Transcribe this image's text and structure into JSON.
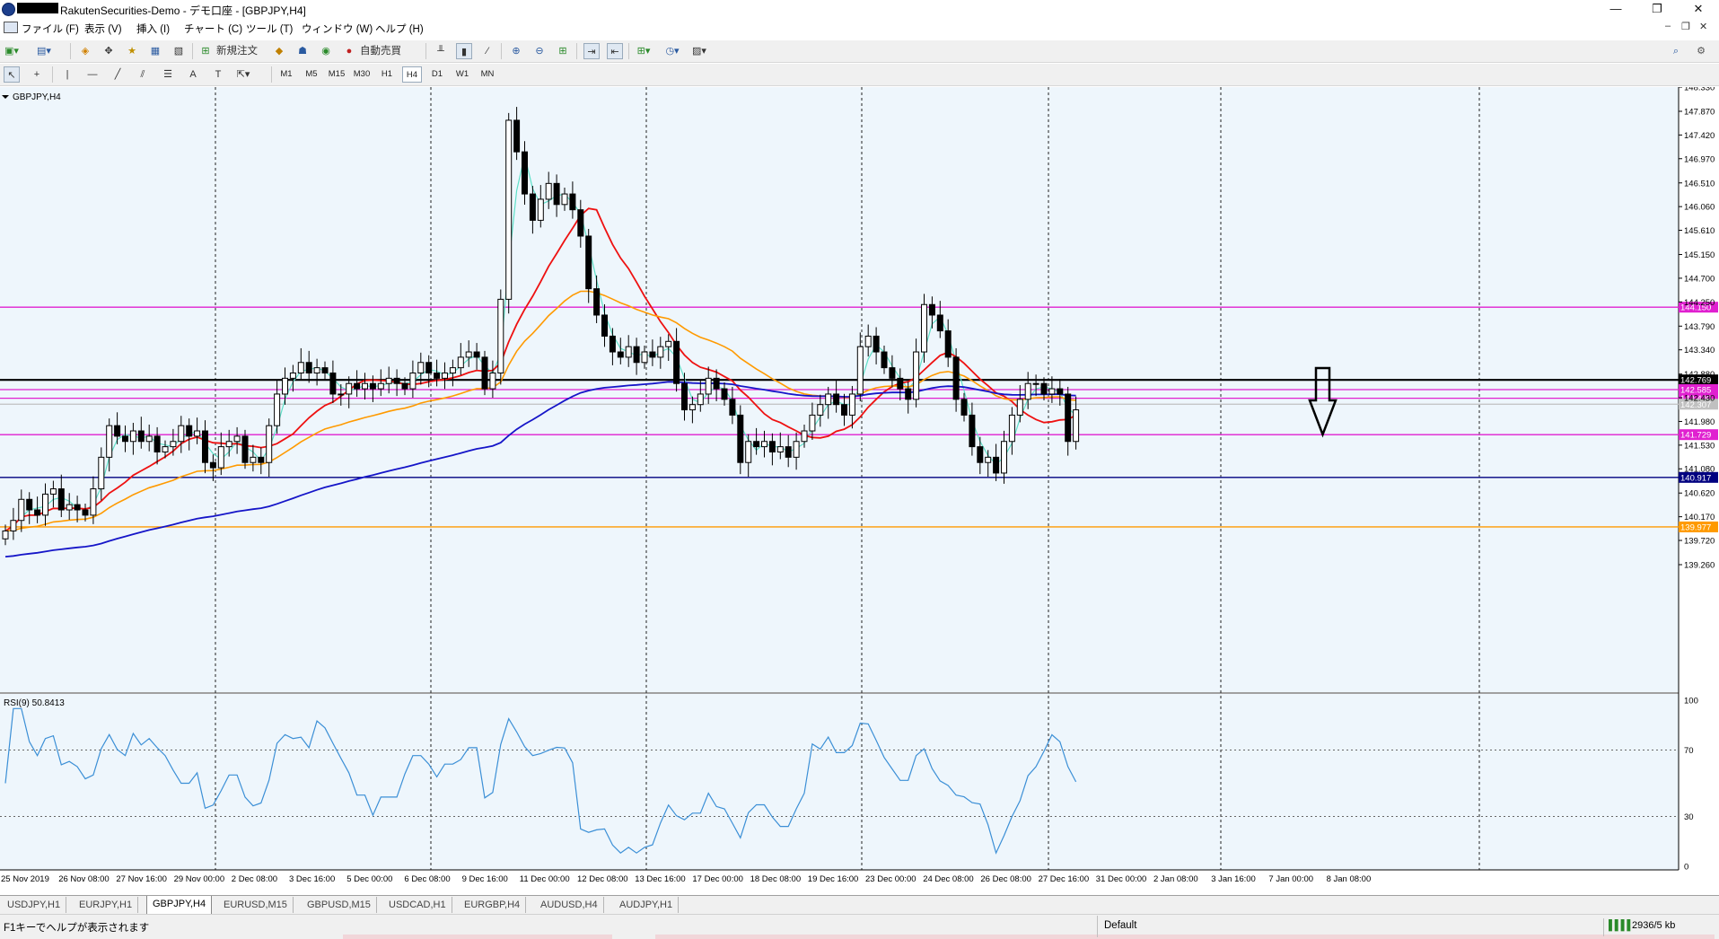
{
  "window": {
    "title": "RakutenSecurities-Demo - デモ口座 - [GBPJPY,H4]",
    "minimize": "—",
    "restore": "❐",
    "close": "✕"
  },
  "menu": [
    "ファイル (F)",
    "表示 (V)",
    "挿入 (I)",
    "チャート (C)",
    "ツール (T)",
    "ウィンドウ (W)",
    "ヘルプ (H)"
  ],
  "toolbar": {
    "new_order": "新規注文",
    "auto_trade": "自動売買",
    "timeframes": [
      "M1",
      "M5",
      "M15",
      "M30",
      "H1",
      "H4",
      "D1",
      "W1",
      "MN"
    ],
    "active_timeframe": "H4"
  },
  "chart_label": "GBPJPY,H4",
  "rsi_label": "RSI(9) 50.8413",
  "chart_data": {
    "type": "candlestick",
    "symbol": "GBPJPY",
    "timeframe": "H4",
    "ylim": [
      139.26,
      148.33
    ],
    "y_ticks": [
      "148.330",
      "147.870",
      "147.420",
      "146.970",
      "146.510",
      "146.060",
      "145.610",
      "145.150",
      "144.700",
      "144.250",
      "143.790",
      "143.340",
      "142.880",
      "142.430",
      "141.980",
      "141.530",
      "141.080",
      "140.620",
      "140.170",
      "139.720",
      "139.260"
    ],
    "x_labels": [
      "25 Nov 2019",
      "26 Nov 08:00",
      "27 Nov 16:00",
      "29 Nov 00:00",
      "2 Dec 08:00",
      "3 Dec 16:00",
      "5 Dec 00:00",
      "6 Dec 08:00",
      "9 Dec 16:00",
      "11 Dec 00:00",
      "12 Dec 08:00",
      "13 Dec 16:00",
      "17 Dec 00:00",
      "18 Dec 08:00",
      "19 Dec 16:00",
      "23 Dec 00:00",
      "24 Dec 08:00",
      "26 Dec 08:00",
      "27 Dec 16:00",
      "31 Dec 00:00",
      "2 Jan 08:00",
      "3 Jan 16:00",
      "7 Jan 00:00",
      "8 Jan 08:00"
    ],
    "closes": [
      139.9,
      140.1,
      140.5,
      140.3,
      140.2,
      140.6,
      140.7,
      140.3,
      140.4,
      140.3,
      140.2,
      140.7,
      141.3,
      141.9,
      141.7,
      141.6,
      141.8,
      141.6,
      141.7,
      141.4,
      141.5,
      141.6,
      141.9,
      141.7,
      141.8,
      141.2,
      141.1,
      141.5,
      141.6,
      141.7,
      141.2,
      141.3,
      141.2,
      141.9,
      142.5,
      142.8,
      142.9,
      143.1,
      142.9,
      143.0,
      142.9,
      142.5,
      142.5,
      142.7,
      142.6,
      142.7,
      142.6,
      142.7,
      142.8,
      142.7,
      142.6,
      142.9,
      143.1,
      142.9,
      142.8,
      142.9,
      143.0,
      143.2,
      143.3,
      143.2,
      142.6,
      142.9,
      144.3,
      147.7,
      147.1,
      146.3,
      145.8,
      146.2,
      146.5,
      146.1,
      146.3,
      146.0,
      145.5,
      144.5,
      144.0,
      143.6,
      143.3,
      143.2,
      143.4,
      143.1,
      143.3,
      143.2,
      143.4,
      143.5,
      142.7,
      142.2,
      142.3,
      142.5,
      142.8,
      142.6,
      142.4,
      142.1,
      141.2,
      141.6,
      141.5,
      141.6,
      141.4,
      141.5,
      141.3,
      141.6,
      141.8,
      142.1,
      142.3,
      142.5,
      142.3,
      142.1,
      142.5,
      143.4,
      143.6,
      143.3,
      143.0,
      142.8,
      142.6,
      142.4,
      143.3,
      144.2,
      144.0,
      143.7,
      143.2,
      142.4,
      142.1,
      141.5,
      141.2,
      141.3,
      141.0,
      141.6,
      142.1,
      142.4,
      142.7,
      142.7,
      142.5,
      142.6,
      142.5,
      141.6,
      142.2
    ],
    "series": [
      {
        "name": "MA fast",
        "color": "#5fe0c8"
      },
      {
        "name": "MA 21",
        "color": "#ee1111"
      },
      {
        "name": "MA 75",
        "color": "#ff9a00"
      },
      {
        "name": "MA 200",
        "color": "#1515c8"
      }
    ],
    "horizontal_levels": [
      {
        "price": 144.15,
        "label": "144.150",
        "color": "#e020d0"
      },
      {
        "price": 142.769,
        "label": "142.769",
        "color": "#000000"
      },
      {
        "price": 142.585,
        "label": "142.585",
        "color": "#e020d0"
      },
      {
        "price": 142.42,
        "label": "142.420",
        "color": "#e020d0"
      },
      {
        "price": 142.307,
        "label": "142.307",
        "color": "#c0c0c0"
      },
      {
        "price": 141.729,
        "label": "141.729",
        "color": "#e020d0"
      },
      {
        "price": 140.917,
        "label": "140.917",
        "color": "#000080"
      },
      {
        "price": 139.977,
        "label": "139.977",
        "color": "#ff9a00"
      }
    ],
    "rsi": {
      "period": 9,
      "current": 50.8413,
      "levels": [
        30,
        70
      ],
      "y_ticks": [
        "100",
        "70",
        "30",
        "0"
      ],
      "ylim": [
        0,
        100
      ]
    }
  },
  "tabs": [
    "USDJPY,H1",
    "EURJPY,H1",
    "GBPJPY,H4",
    "EURUSD,M15",
    "GBPUSD,M15",
    "USDCAD,H1",
    "EURGBP,H4",
    "AUDUSD,H4",
    "AUDJPY,H1"
  ],
  "active_tab": "GBPJPY,H4",
  "status": {
    "help": "F1キーでヘルプが表示されます",
    "profile": "Default",
    "traffic": "2936/5 kb"
  }
}
